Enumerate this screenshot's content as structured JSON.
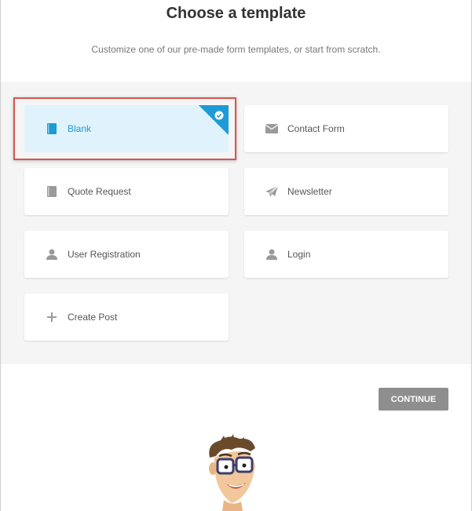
{
  "header": {
    "title": "Choose a template",
    "subtitle": "Customize one of our pre-made form templates, or start from scratch."
  },
  "templates": [
    {
      "label": "Blank",
      "icon": "book-icon",
      "selected": true
    },
    {
      "label": "Contact Form",
      "icon": "envelope-icon",
      "selected": false
    },
    {
      "label": "Quote Request",
      "icon": "book-icon",
      "selected": false
    },
    {
      "label": "Newsletter",
      "icon": "paper-plane-icon",
      "selected": false
    },
    {
      "label": "User Registration",
      "icon": "user-icon",
      "selected": false
    },
    {
      "label": "Login",
      "icon": "user-icon",
      "selected": false
    },
    {
      "label": "Create Post",
      "icon": "plus-icon",
      "selected": false
    }
  ],
  "footer": {
    "continue_label": "CONTINUE"
  },
  "colors": {
    "accent": "#1e9ad6",
    "selected_bg": "#e0f3fc",
    "highlight_border": "#d9534f",
    "button_bg": "#8e8e8e",
    "icon_gray": "#9a9a9a"
  }
}
